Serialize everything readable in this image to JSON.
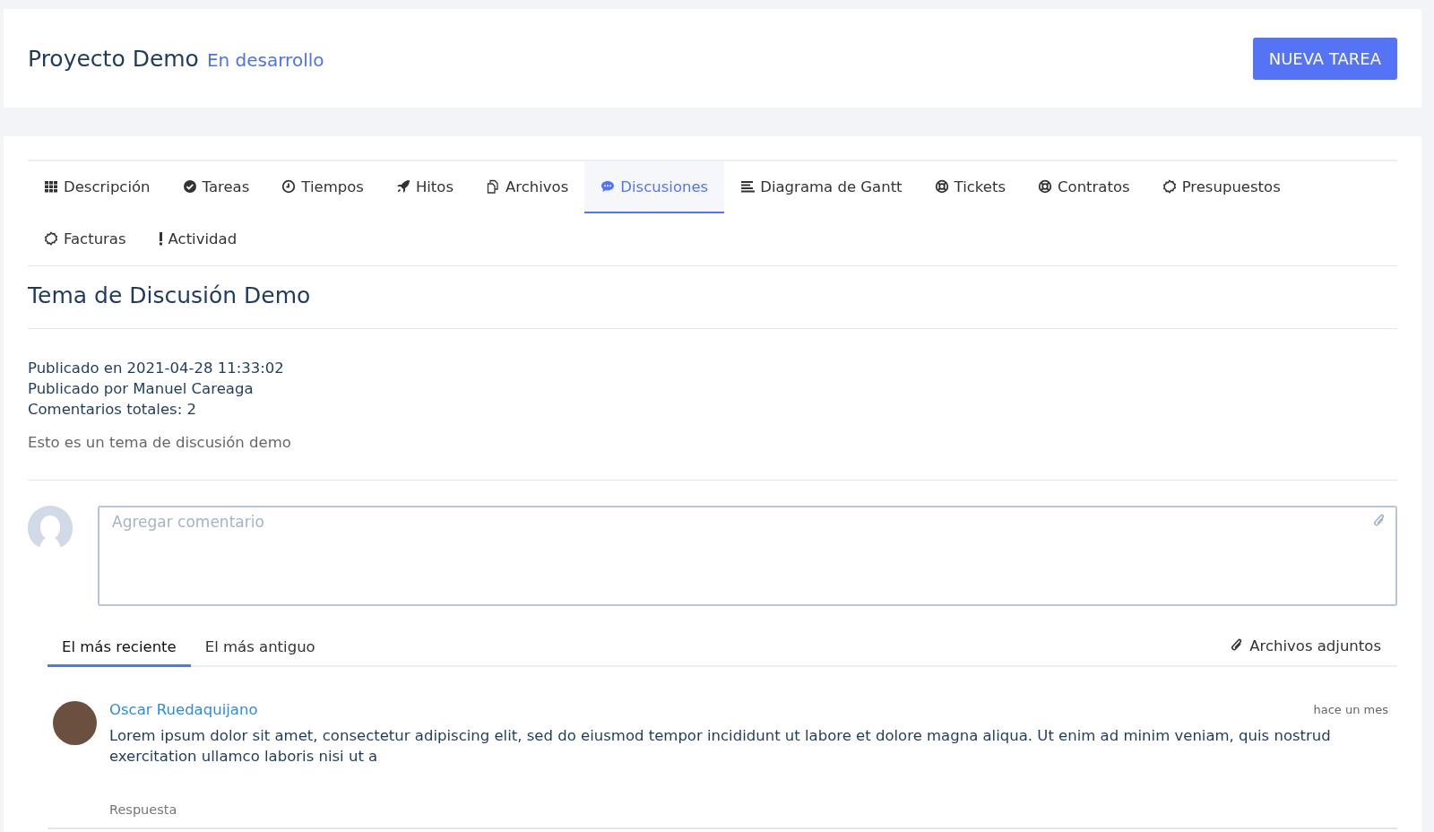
{
  "header": {
    "title": "Proyecto Demo",
    "status": "En desarrollo",
    "button": "NUEVA TAREA"
  },
  "tabs": [
    {
      "label": "Descripción",
      "selected": false
    },
    {
      "label": "Tareas",
      "selected": false
    },
    {
      "label": "Tiempos",
      "selected": false
    },
    {
      "label": "Hitos",
      "selected": false
    },
    {
      "label": "Archivos",
      "selected": false
    },
    {
      "label": "Discusiones",
      "selected": true
    },
    {
      "label": "Diagrama de Gantt",
      "selected": false
    },
    {
      "label": "Tickets",
      "selected": false
    },
    {
      "label": "Contratos",
      "selected": false
    },
    {
      "label": "Presupuestos",
      "selected": false
    },
    {
      "label": "Facturas",
      "selected": false
    },
    {
      "label": "Actividad",
      "selected": false
    }
  ],
  "discussion": {
    "title": "Tema de Discusión Demo",
    "meta": [
      "Publicado en 2021-04-28 11:33:02",
      "Publicado por Manuel Careaga",
      "Comentarios totales: 2"
    ],
    "description": "Esto es un tema de discusión demo"
  },
  "comment_box": {
    "placeholder": "Agregar comentario"
  },
  "sort_tabs": [
    {
      "label": "El más reciente",
      "selected": true
    },
    {
      "label": "El más antiguo",
      "selected": false
    }
  ],
  "attachments_link": "Archivos adjuntos",
  "comments": [
    {
      "author": "Oscar Ruedaquijano",
      "time": "hace un mes",
      "text": "Lorem ipsum dolor sit amet, consectetur adipiscing elit, sed do eiusmod tempor incididunt ut labore et dolore magna aliqua. Ut enim ad minim veniam, quis nostrud exercitation ullamco laboris nisi ut a",
      "reply": "Respuesta"
    }
  ]
}
